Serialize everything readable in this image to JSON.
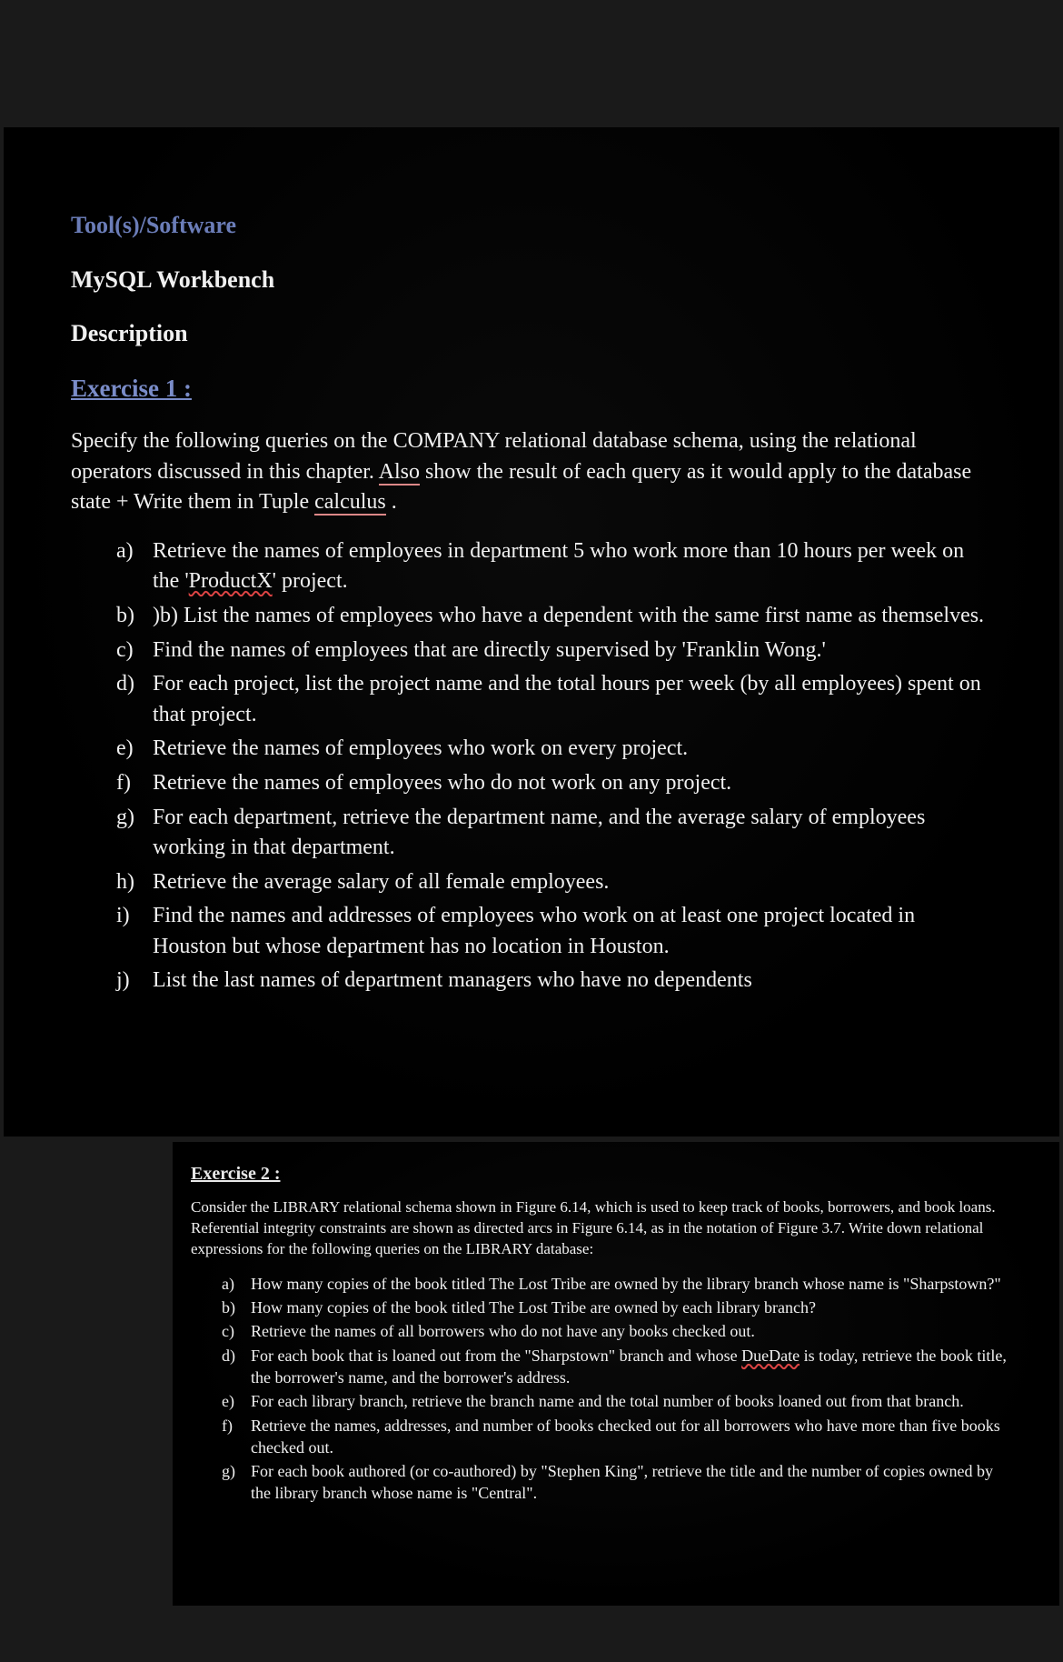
{
  "frame1": {
    "tools_label": "Tool(s)/Software",
    "tools_value": "MySQL Workbench",
    "description_label": "Description",
    "exercise_title": "Exercise 1 :",
    "preamble": "Specify the following queries on the COMPANY relational database schema, using the relational operators discussed in this chapter. Also show the result of each query as it would apply to the database state + Write them in Tuple calculus .",
    "items": [
      {
        "label": "a)",
        "text": "Retrieve the names of employees in department 5 who work more than 10 hours per week on the 'ProductX' project."
      },
      {
        "label": "b)",
        "text": ")b) List the names of employees who have a dependent with the same first name as themselves."
      },
      {
        "label": "c)",
        "text": "Find the names of employees that are directly supervised by 'Franklin Wong.'"
      },
      {
        "label": "d)",
        "text": "For each project, list the project name and the total hours per week (by all employees) spent on that project."
      },
      {
        "label": "e)",
        "text": "Retrieve the names of employees who work on every project."
      },
      {
        "label": "f)",
        "text": "Retrieve the names of employees who do not work on any project."
      },
      {
        "label": "g)",
        "text": "For each department, retrieve the department name, and the average salary of employees working in that department."
      },
      {
        "label": "h)",
        "text": "Retrieve the average salary of all female employees."
      },
      {
        "label": "i)",
        "text": "Find the names and addresses of employees who work on at least one project located in Houston but whose department has no location in Houston."
      },
      {
        "label": "j)",
        "text": "List the last names of department managers who have no dependents"
      }
    ],
    "squiggle_words": [
      "Also",
      "calculus",
      "ProductX"
    ]
  },
  "frame2": {
    "exercise_title": "Exercise 2 :",
    "preamble": "Consider the LIBRARY relational schema shown in Figure 6.14, which is used to keep track of books, borrowers, and book loans. Referential integrity constraints are shown as directed arcs in Figure 6.14, as in the notation of Figure 3.7. Write down relational expressions for the following queries on the LIBRARY database:",
    "items": [
      {
        "label": "a)",
        "text": "How many copies of the book titled The Lost Tribe are owned by the library branch whose name is \"Sharpstown?\""
      },
      {
        "label": "b)",
        "text": "How many copies of the book titled The Lost Tribe are owned by each library branch?"
      },
      {
        "label": "c)",
        "text": "Retrieve the names of all borrowers who do not have any books checked out."
      },
      {
        "label": "d)",
        "text": "For each book that is loaned out from the \"Sharpstown\" branch and whose DueDate is today, retrieve the book title, the borrower's name, and the borrower's address."
      },
      {
        "label": "e)",
        "text": "For each library branch, retrieve the branch name and the total number of books loaned out from that branch."
      },
      {
        "label": "f)",
        "text": "Retrieve the names, addresses, and number of books checked out for all borrowers who have more than five books checked out."
      },
      {
        "label": "g)",
        "text": "For each book authored (or co-authored) by \"Stephen King\", retrieve the title and the number of copies owned by the library branch whose name is \"Central\"."
      }
    ],
    "squiggle_words": [
      "DueDate"
    ]
  }
}
